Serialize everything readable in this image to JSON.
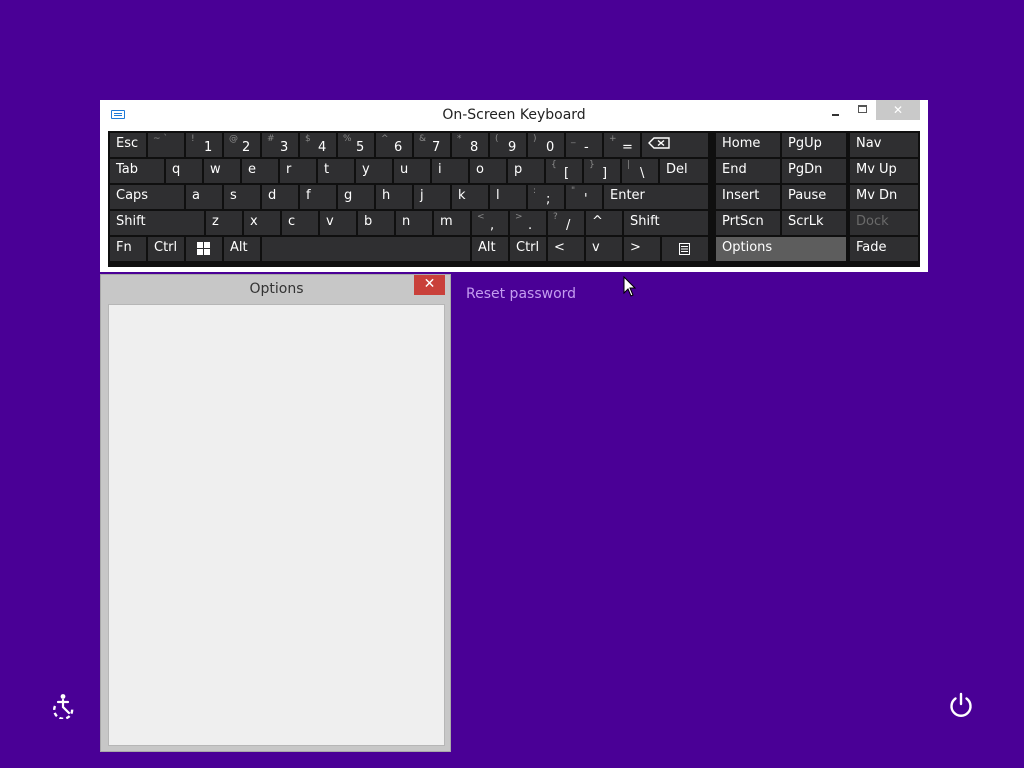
{
  "osk": {
    "title": "On-Screen Keyboard",
    "buttons": {
      "minimize": "minimize",
      "maximize": "maximize",
      "close": "✕"
    },
    "rows": [
      [
        {
          "label": "Esc"
        },
        {
          "sub": "~ `"
        },
        {
          "sub": "!",
          "main": "1"
        },
        {
          "sub": "@",
          "main": "2"
        },
        {
          "sub": "#",
          "main": "3"
        },
        {
          "sub": "$",
          "main": "4"
        },
        {
          "sub": "%",
          "main": "5"
        },
        {
          "sub": "^",
          "main": "6"
        },
        {
          "sub": "&",
          "main": "7"
        },
        {
          "sub": "*",
          "main": "8"
        },
        {
          "sub": "(",
          "main": "9"
        },
        {
          "sub": ")",
          "main": "0"
        },
        {
          "sub": "_",
          "main": "-"
        },
        {
          "sub": "+",
          "main": "="
        },
        {
          "icon": "backspace-icon"
        }
      ],
      [
        {
          "label": "Tab"
        },
        {
          "label": "q"
        },
        {
          "label": "w"
        },
        {
          "label": "e"
        },
        {
          "label": "r"
        },
        {
          "label": "t"
        },
        {
          "label": "y"
        },
        {
          "label": "u"
        },
        {
          "label": "i"
        },
        {
          "label": "o"
        },
        {
          "label": "p"
        },
        {
          "sub": "{",
          "main": "["
        },
        {
          "sub": "}",
          "main": "]"
        },
        {
          "sub": "|",
          "main": "\\"
        },
        {
          "label": "Del"
        }
      ],
      [
        {
          "label": "Caps"
        },
        {
          "label": "a"
        },
        {
          "label": "s"
        },
        {
          "label": "d"
        },
        {
          "label": "f"
        },
        {
          "label": "g"
        },
        {
          "label": "h"
        },
        {
          "label": "j"
        },
        {
          "label": "k"
        },
        {
          "label": "l"
        },
        {
          "sub": ":",
          "main": ";"
        },
        {
          "sub": "\"",
          "main": "'"
        },
        {
          "label": "Enter"
        }
      ],
      [
        {
          "label": "Shift"
        },
        {
          "label": "z"
        },
        {
          "label": "x"
        },
        {
          "label": "c"
        },
        {
          "label": "v"
        },
        {
          "label": "b"
        },
        {
          "label": "n"
        },
        {
          "label": "m"
        },
        {
          "sub": "<",
          "main": ","
        },
        {
          "sub": ">",
          "main": "."
        },
        {
          "sub": "?",
          "main": "/"
        },
        {
          "label": "^"
        },
        {
          "label": "Shift"
        }
      ],
      [
        {
          "label": "Fn"
        },
        {
          "label": "Ctrl"
        },
        {
          "icon": "windows-icon"
        },
        {
          "label": "Alt"
        },
        {
          "label": ""
        },
        {
          "label": "Alt"
        },
        {
          "label": "Ctrl"
        },
        {
          "label": "<"
        },
        {
          "label": "v"
        },
        {
          "label": ">"
        },
        {
          "icon": "menu-icon"
        }
      ]
    ],
    "nav_keys": [
      [
        "Home",
        "PgUp"
      ],
      [
        "End",
        "PgDn"
      ],
      [
        "Insert",
        "Pause"
      ],
      [
        "PrtScn",
        "ScrLk"
      ],
      [
        "Options",
        ""
      ]
    ],
    "side_keys": [
      "Nav",
      "Mv Up",
      "Mv Dn",
      "Dock",
      "Fade"
    ]
  },
  "options_window": {
    "title": "Options",
    "close": "✕"
  },
  "login": {
    "reset_password": "Reset password"
  },
  "colors": {
    "background": "#4a0096",
    "key": "#2f2f31",
    "link": "#c49cf0",
    "close_red": "#c9403a"
  }
}
